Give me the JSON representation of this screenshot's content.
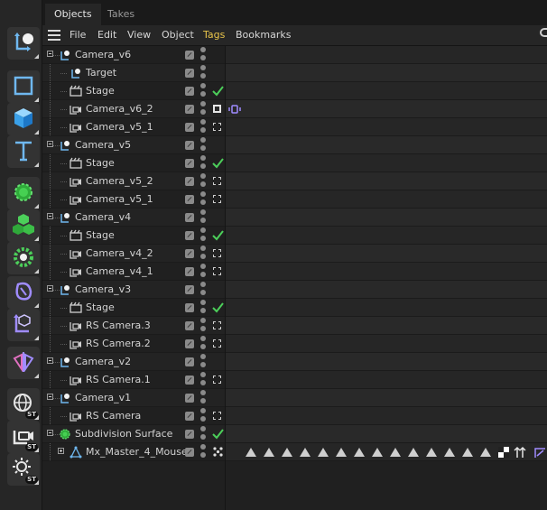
{
  "tabs": [
    {
      "label": "Objects",
      "active": true
    },
    {
      "label": "Takes",
      "active": false
    }
  ],
  "menu": [
    "File",
    "Edit",
    "View",
    "Object",
    "Tags",
    "Bookmarks"
  ],
  "highlighted_menu": "Tags",
  "toolbar": [
    {
      "name": "null-axis-tool",
      "icon": "null-axis-icon"
    },
    {
      "name": "rectangle-tool",
      "icon": "rectangle-icon"
    },
    {
      "name": "cube-tool",
      "icon": "cube-icon"
    },
    {
      "name": "text-tool",
      "icon": "text-icon"
    },
    {
      "name": "subdivision-tool",
      "icon": "subdivision-icon"
    },
    {
      "name": "cloner-tool",
      "icon": "cloner-icon"
    },
    {
      "name": "effector-tool",
      "icon": "effector-icon"
    },
    {
      "name": "deformer-tool",
      "icon": "deformer-icon"
    },
    {
      "name": "connector-tool",
      "icon": "connector-icon"
    },
    {
      "name": "symmetry-tool",
      "icon": "symmetry-icon"
    },
    {
      "name": "environment-tool",
      "icon": "globe-icon",
      "badge": "ST"
    },
    {
      "name": "camera-tool",
      "icon": "camera-icon",
      "badge": "ST"
    },
    {
      "name": "light-tool",
      "icon": "light-icon",
      "badge": "ST"
    }
  ],
  "objects": [
    {
      "label": "Camera_v6",
      "depth": 0,
      "icon": "null-icon",
      "expanded": true,
      "tag": ""
    },
    {
      "label": "Target",
      "depth": 1,
      "icon": "null-icon",
      "tag": ""
    },
    {
      "label": "Stage",
      "depth": 1,
      "icon": "stage-icon",
      "tag": "check"
    },
    {
      "label": "Camera_v6_2",
      "depth": 1,
      "icon": "camera-icon",
      "tag": "solid",
      "extra": "vibrate-tag"
    },
    {
      "label": "Camera_v5_1",
      "depth": 1,
      "icon": "camera-icon",
      "tag": "target"
    },
    {
      "label": "Camera_v5",
      "depth": 0,
      "icon": "null-icon",
      "expanded": true,
      "tag": ""
    },
    {
      "label": "Stage",
      "depth": 1,
      "icon": "stage-icon",
      "tag": "check"
    },
    {
      "label": "Camera_v5_2",
      "depth": 1,
      "icon": "camera-icon",
      "tag": "target"
    },
    {
      "label": "Camera_v5_1",
      "depth": 1,
      "icon": "camera-icon",
      "tag": "target"
    },
    {
      "label": "Camera_v4",
      "depth": 0,
      "icon": "null-icon",
      "expanded": true,
      "tag": ""
    },
    {
      "label": "Stage",
      "depth": 1,
      "icon": "stage-icon",
      "tag": "check"
    },
    {
      "label": "Camera_v4_2",
      "depth": 1,
      "icon": "camera-icon",
      "tag": "target"
    },
    {
      "label": "Camera_v4_1",
      "depth": 1,
      "icon": "camera-icon",
      "tag": "target"
    },
    {
      "label": "Camera_v3",
      "depth": 0,
      "icon": "null-icon",
      "expanded": true,
      "tag": ""
    },
    {
      "label": "Stage",
      "depth": 1,
      "icon": "stage-icon",
      "tag": "check"
    },
    {
      "label": "RS Camera.3",
      "depth": 1,
      "icon": "camera-icon",
      "tag": "target"
    },
    {
      "label": "RS Camera.2",
      "depth": 1,
      "icon": "camera-icon",
      "tag": "target"
    },
    {
      "label": "Camera_v2",
      "depth": 0,
      "icon": "null-icon",
      "expanded": true,
      "tag": ""
    },
    {
      "label": "RS Camera.1",
      "depth": 1,
      "icon": "camera-icon",
      "tag": "target"
    },
    {
      "label": "Camera_v1",
      "depth": 0,
      "icon": "null-icon",
      "expanded": true,
      "tag": ""
    },
    {
      "label": "RS Camera",
      "depth": 1,
      "icon": "camera-icon",
      "tag": "target"
    },
    {
      "label": "Subdivision Surface",
      "depth": 0,
      "icon": "subdivision-icon",
      "expanded": true,
      "tag": "check"
    },
    {
      "label": "Mx_Master_4_Mouse",
      "depth": 1,
      "icon": "polygon-icon",
      "collapsed": true,
      "tag": "dots",
      "extra": "material-tags"
    }
  ],
  "colors": {
    "accent_blue": "#6fb8f0",
    "check_green": "#4ccf5a",
    "highlight_yellow": "#e8c44a",
    "vibrate_purple": "#a08cff"
  }
}
